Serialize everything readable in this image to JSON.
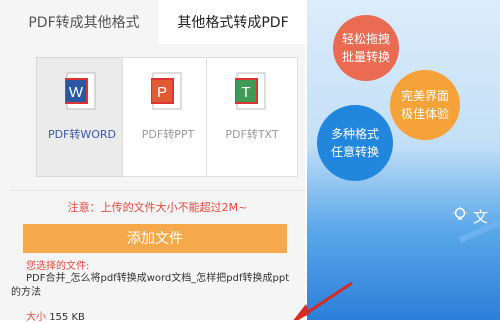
{
  "tabs": [
    {
      "label": "PDF转成其他格式",
      "active": true
    },
    {
      "label": "其他格式转成PDF",
      "active": false
    }
  ],
  "tiles": [
    {
      "letter": "W",
      "label": "PDF转WORD",
      "color": "#2b56a3",
      "selected": true
    },
    {
      "letter": "P",
      "label": "PDF转PPT",
      "color": "#e05a36",
      "selected": false
    },
    {
      "letter": "T",
      "label": "PDF转TXT",
      "color": "#3f9a55",
      "selected": false
    }
  ],
  "notice": "注意：上传的文件大小不能超过2M~",
  "add_button": "添加文件",
  "chosen_label": "您选择的文件:",
  "file_name_line1": "PDF合并_怎么将pdf转换成word文档_怎样把pdf转换成ppt",
  "file_name_line2": "的方法",
  "size_label": "大小",
  "size_value": "155 KB",
  "promo": {
    "bubble1": [
      "轻松拖拽",
      "批量转换"
    ],
    "bubble2": [
      "完美界面",
      "极佳体验"
    ],
    "bubble3": [
      "多种格式",
      "任意转换"
    ],
    "partial_text": "文"
  },
  "colors": {
    "accent_orange": "#f5a94a",
    "notice_red": "#e64a3f",
    "word_blue": "#2b56a3",
    "ppt_orange": "#e05a36",
    "txt_green": "#3f9a55"
  }
}
